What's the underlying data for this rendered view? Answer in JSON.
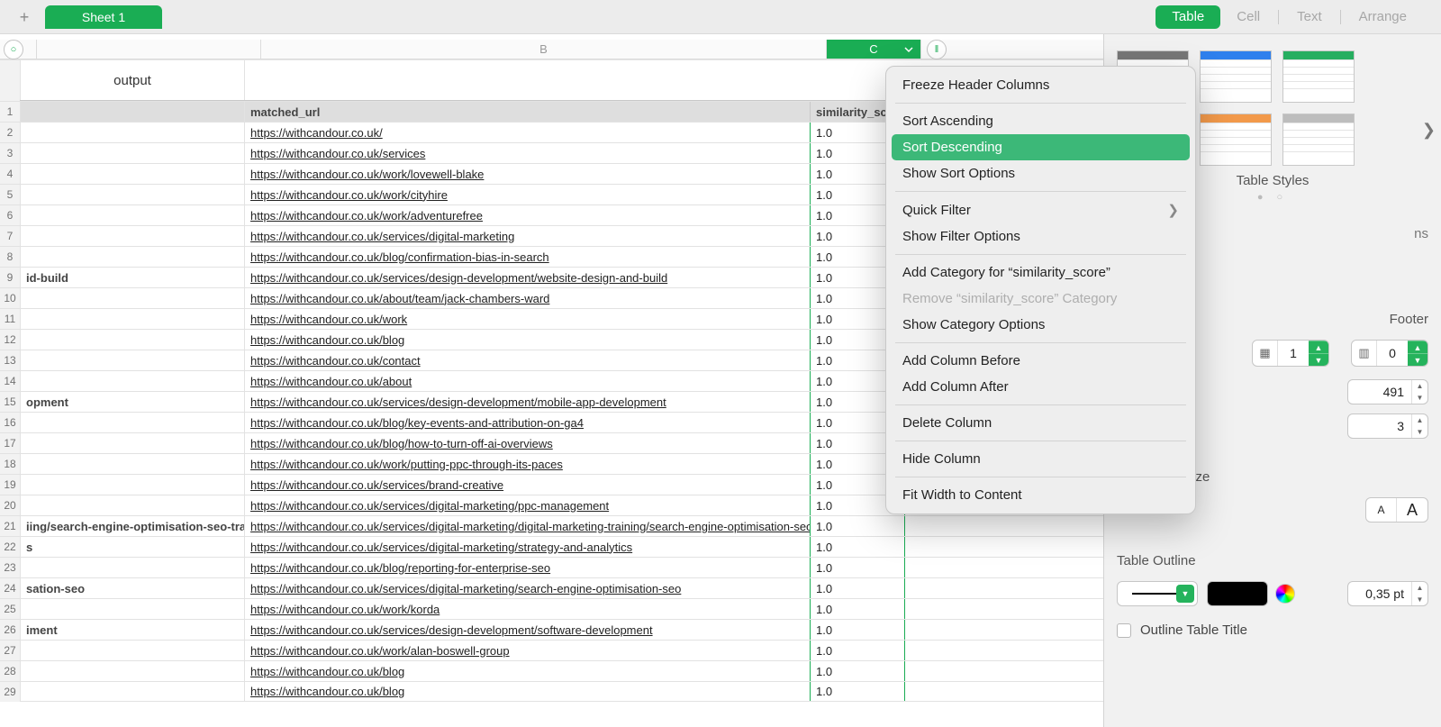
{
  "toolbar": {
    "sheet_tab": "Sheet 1",
    "format_tab_table": "Table",
    "format_tab_cell": "Cell",
    "format_tab_text": "Text",
    "format_tab_arrange": "Arrange"
  },
  "columns": {
    "a_output_title": "output",
    "b_letter": "B",
    "c_letter": "C",
    "header_a": "",
    "header_b": "matched_url",
    "header_c": "similarity_sco"
  },
  "rows": [
    {
      "a": "",
      "b": "https://withcandour.co.uk/",
      "c": "1.0"
    },
    {
      "a": "",
      "b": "https://withcandour.co.uk/services",
      "c": "1.0"
    },
    {
      "a": "",
      "b": "https://withcandour.co.uk/work/lovewell-blake",
      "c": "1.0"
    },
    {
      "a": "",
      "b": "https://withcandour.co.uk/work/cityhire",
      "c": "1.0"
    },
    {
      "a": "",
      "b": "https://withcandour.co.uk/work/adventurefree",
      "c": "1.0"
    },
    {
      "a": "",
      "b": "https://withcandour.co.uk/services/digital-marketing",
      "c": "1.0"
    },
    {
      "a": "",
      "b": "https://withcandour.co.uk/blog/confirmation-bias-in-search",
      "c": "1.0"
    },
    {
      "a": "id-build",
      "b": "https://withcandour.co.uk/services/design-development/website-design-and-build",
      "c": "1.0"
    },
    {
      "a": "",
      "b": "https://withcandour.co.uk/about/team/jack-chambers-ward",
      "c": "1.0"
    },
    {
      "a": "",
      "b": "https://withcandour.co.uk/work",
      "c": "1.0"
    },
    {
      "a": "",
      "b": "https://withcandour.co.uk/blog",
      "c": "1.0"
    },
    {
      "a": "",
      "b": "https://withcandour.co.uk/contact",
      "c": "1.0"
    },
    {
      "a": "",
      "b": "https://withcandour.co.uk/about",
      "c": "1.0"
    },
    {
      "a": "opment",
      "b": "https://withcandour.co.uk/services/design-development/mobile-app-development",
      "c": "1.0"
    },
    {
      "a": "",
      "b": "https://withcandour.co.uk/blog/key-events-and-attribution-on-ga4",
      "c": "1.0"
    },
    {
      "a": "",
      "b": "https://withcandour.co.uk/blog/how-to-turn-off-ai-overviews",
      "c": "1.0"
    },
    {
      "a": "",
      "b": "https://withcandour.co.uk/work/putting-ppc-through-its-paces",
      "c": "1.0"
    },
    {
      "a": "",
      "b": "https://withcandour.co.uk/services/brand-creative",
      "c": "1.0"
    },
    {
      "a": "",
      "b": "https://withcandour.co.uk/services/digital-marketing/ppc-management",
      "c": "1.0"
    },
    {
      "a": "iing/search-engine-optimisation-seo-training",
      "b": "https://withcandour.co.uk/services/digital-marketing/digital-marketing-training/search-engine-optimisation-seo-training",
      "c": "1.0"
    },
    {
      "a": "s",
      "b": "https://withcandour.co.uk/services/digital-marketing/strategy-and-analytics",
      "c": "1.0"
    },
    {
      "a": "",
      "b": "https://withcandour.co.uk/blog/reporting-for-enterprise-seo",
      "c": "1.0"
    },
    {
      "a": "sation-seo",
      "b": "https://withcandour.co.uk/services/digital-marketing/search-engine-optimisation-seo",
      "c": "1.0"
    },
    {
      "a": "",
      "b": "https://withcandour.co.uk/work/korda",
      "c": "1.0"
    },
    {
      "a": "iment",
      "b": "https://withcandour.co.uk/services/design-development/software-development",
      "c": "1.0"
    },
    {
      "a": "",
      "b": "https://withcandour.co.uk/work/alan-boswell-group",
      "c": "1.0"
    },
    {
      "a": "",
      "b": "https://withcandour.co.uk/blog",
      "c": "1.0"
    },
    {
      "a": "",
      "b": "https://withcandour.co.uk/blog",
      "c": "1.0"
    }
  ],
  "context_menu": {
    "freeze": "Freeze Header Columns",
    "sort_asc": "Sort Ascending",
    "sort_desc": "Sort Descending",
    "sort_opts": "Show Sort Options",
    "quick_filter": "Quick Filter",
    "filter_opts": "Show Filter Options",
    "add_cat": "Add Category for “similarity_score”",
    "rem_cat": "Remove “similarity_score” Category",
    "cat_opts": "Show Category Options",
    "col_before": "Add Column Before",
    "col_after": "Add Column After",
    "del_col": "Delete Column",
    "hide_col": "Hide Column",
    "fit_width": "Fit Width to Content"
  },
  "inspector": {
    "styles_label": "Table Styles",
    "footer_label": "Footer",
    "headers_val": "1",
    "footers_val": "0",
    "rows_val": "491",
    "cols_val": "3",
    "font_size_label": "Table Font Size",
    "font_small": "A",
    "font_large": "A",
    "outline_label": "Table Outline",
    "outline_pt": "0,35 pt",
    "outline_title_chk": "Outline Table Title",
    "truncated_label_ns": "ns"
  }
}
